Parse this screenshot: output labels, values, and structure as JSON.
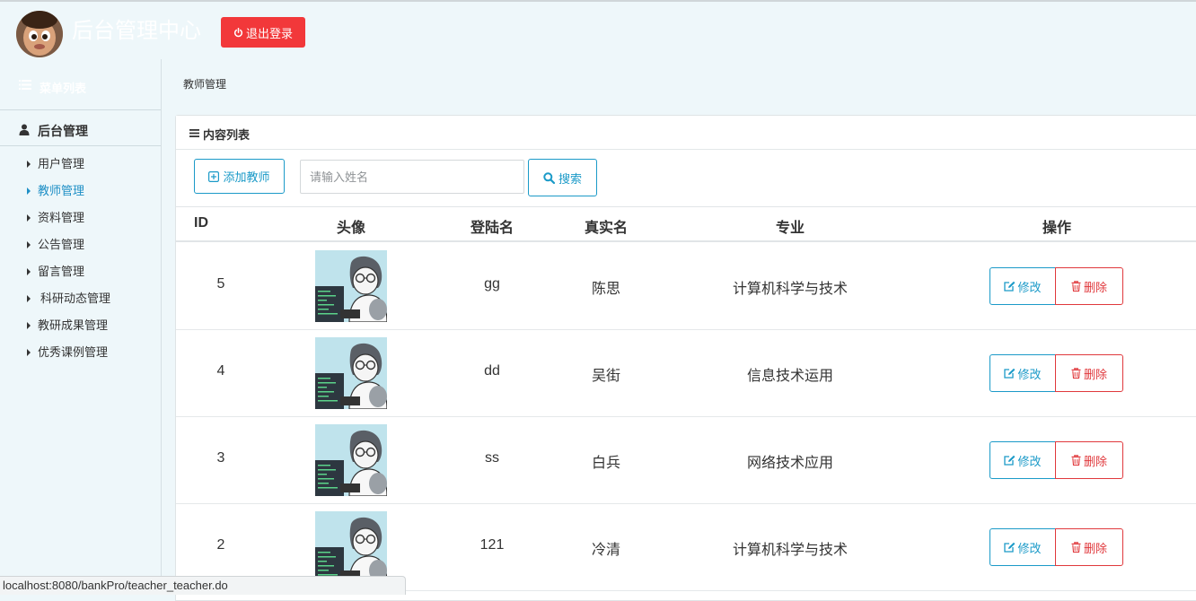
{
  "header": {
    "title": "后台管理中心",
    "logout_label": "退出登录"
  },
  "sidebar": {
    "menu_head": "菜单列表",
    "section_title": "后台管理",
    "items": [
      {
        "label": "用户管理"
      },
      {
        "label": "教师管理"
      },
      {
        "label": "资料管理"
      },
      {
        "label": "公告管理"
      },
      {
        "label": "留言管理"
      },
      {
        "label": "科研动态管理"
      },
      {
        "label": "教研成果管理"
      },
      {
        "label": "优秀课例管理"
      }
    ]
  },
  "breadcrumb": "教师管理",
  "panel": {
    "title": "内容列表",
    "add_label": "添加教师",
    "search_placeholder": "请输入姓名",
    "search_label": "搜索"
  },
  "table": {
    "headers": {
      "id": "ID",
      "avatar": "头像",
      "login": "登陆名",
      "realname": "真实名",
      "major": "专业",
      "ops": "操作"
    },
    "rows": [
      {
        "id": "5",
        "login": "gg",
        "realname": "陈思",
        "major": "计算机科学与技术"
      },
      {
        "id": "4",
        "login": "dd",
        "realname": "吴街",
        "major": "信息技术运用"
      },
      {
        "id": "3",
        "login": "ss",
        "realname": "白兵",
        "major": "网络技术应用"
      },
      {
        "id": "2",
        "login": "121",
        "realname": "冷清",
        "major": "计算机科学与技术"
      }
    ],
    "edit_label": "修改",
    "delete_label": "删除"
  },
  "status_url": "localhost:8080/bankPro/teacher_teacher.do",
  "colors": {
    "accent": "#1b9ac8",
    "danger": "#e0383c",
    "logout": "#f2383a",
    "background": "#eef7fa"
  }
}
